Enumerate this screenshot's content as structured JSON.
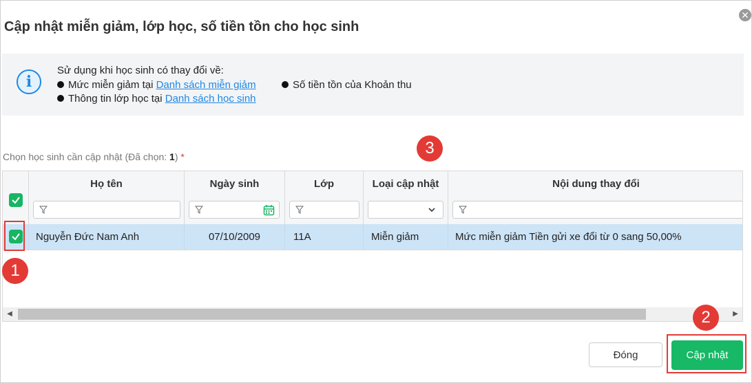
{
  "dialog": {
    "title": "Cập nhật miễn giảm, lớp học, số tiền tồn cho học sinh",
    "close_icon": "close-icon"
  },
  "info": {
    "intro": "Sử dụng khi học sinh có thay đổi về:",
    "item1_prefix": "Mức miễn giảm tại ",
    "item1_link": "Danh sách miễn giảm",
    "item2_prefix": "Thông tin lớp học tại ",
    "item2_link": "Danh sách học sinh",
    "item3": "Số tiền tồn của Khoản thu",
    "icon": "info-icon"
  },
  "selection": {
    "label_prefix": "Chọn học sinh cần cập nhật (Đã chọn: ",
    "count": "1",
    "label_suffix": ")",
    "required_mark": "*"
  },
  "table": {
    "columns": [
      "Họ tên",
      "Ngày sinh",
      "Lớp",
      "Loại cập nhật",
      "Nội dung thay đổi"
    ],
    "rows": [
      {
        "checked": true,
        "name": "Nguyễn Đức Nam Anh",
        "dob": "07/10/2009",
        "class": "11A",
        "update_type": "Miễn giảm",
        "change": "Mức miễn giảm Tiền gửi xe đổi từ 0 sang 50,00%"
      }
    ]
  },
  "buttons": {
    "close": "Đóng",
    "update": "Cập nhật"
  },
  "markers": [
    "1",
    "2",
    "3"
  ],
  "colors": {
    "accent_green": "#17b866",
    "link_blue": "#1e88e5",
    "selected_row": "#cde4f7",
    "marker_red": "#e33a35"
  }
}
